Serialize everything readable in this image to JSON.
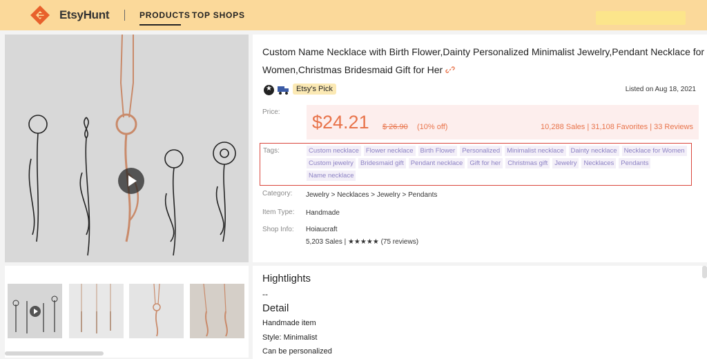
{
  "header": {
    "brand": "EtsyHunt",
    "nav": [
      "PRODUCTS",
      "TOP SHOPS"
    ],
    "accent": "#fbd99a"
  },
  "gallery": {
    "thumbnail_count": 4,
    "main_has_video": true
  },
  "product": {
    "title": "Custom Name Necklace with Birth Flower,Dainty Personalized Minimalist Jewelry,Pendant Necklace for Women,Christmas Bridesmaid Gift for Her",
    "badge": "Etsy's Pick",
    "listed": "Listed on Aug 18, 2021",
    "price_label": "Price:",
    "price": "$24.21",
    "old_price": "$ 26.90",
    "discount": "(10% off)",
    "stats": "10,288 Sales | 31,108 Favorites | 33 Reviews",
    "tags_label": "Tags:",
    "tags": [
      "Custom necklace",
      "Flower necklace",
      "Birth Flower",
      "Personalized",
      "Minimalist necklace",
      "Dainty necklace",
      "Necklace for Women",
      "Custom jewelry",
      "Bridesmaid gift",
      "Pendant necklace",
      "Gift for her",
      "Christmas gift",
      "Jewelry",
      "Necklaces",
      "Pendants",
      "Name necklace"
    ],
    "category_label": "Category:",
    "category": "Jewelry  > Necklaces > Jewelry > Pendants",
    "item_type_label": "Item Type:",
    "item_type": "Handmade",
    "shop_label": "Shop Info:",
    "shop_name": "Hoiaucraft",
    "shop_stats": "5,203 Sales | ★★★★★ (75 reviews)",
    "price_color": "#e8734a",
    "tag_color": "#8c82c4"
  },
  "details": {
    "highlights_title": "Hightlights",
    "highlights_value": "--",
    "detail_title": "Detail",
    "lines": [
      "Handmade item",
      "Style: Minimalist",
      "Can be personalized"
    ]
  }
}
